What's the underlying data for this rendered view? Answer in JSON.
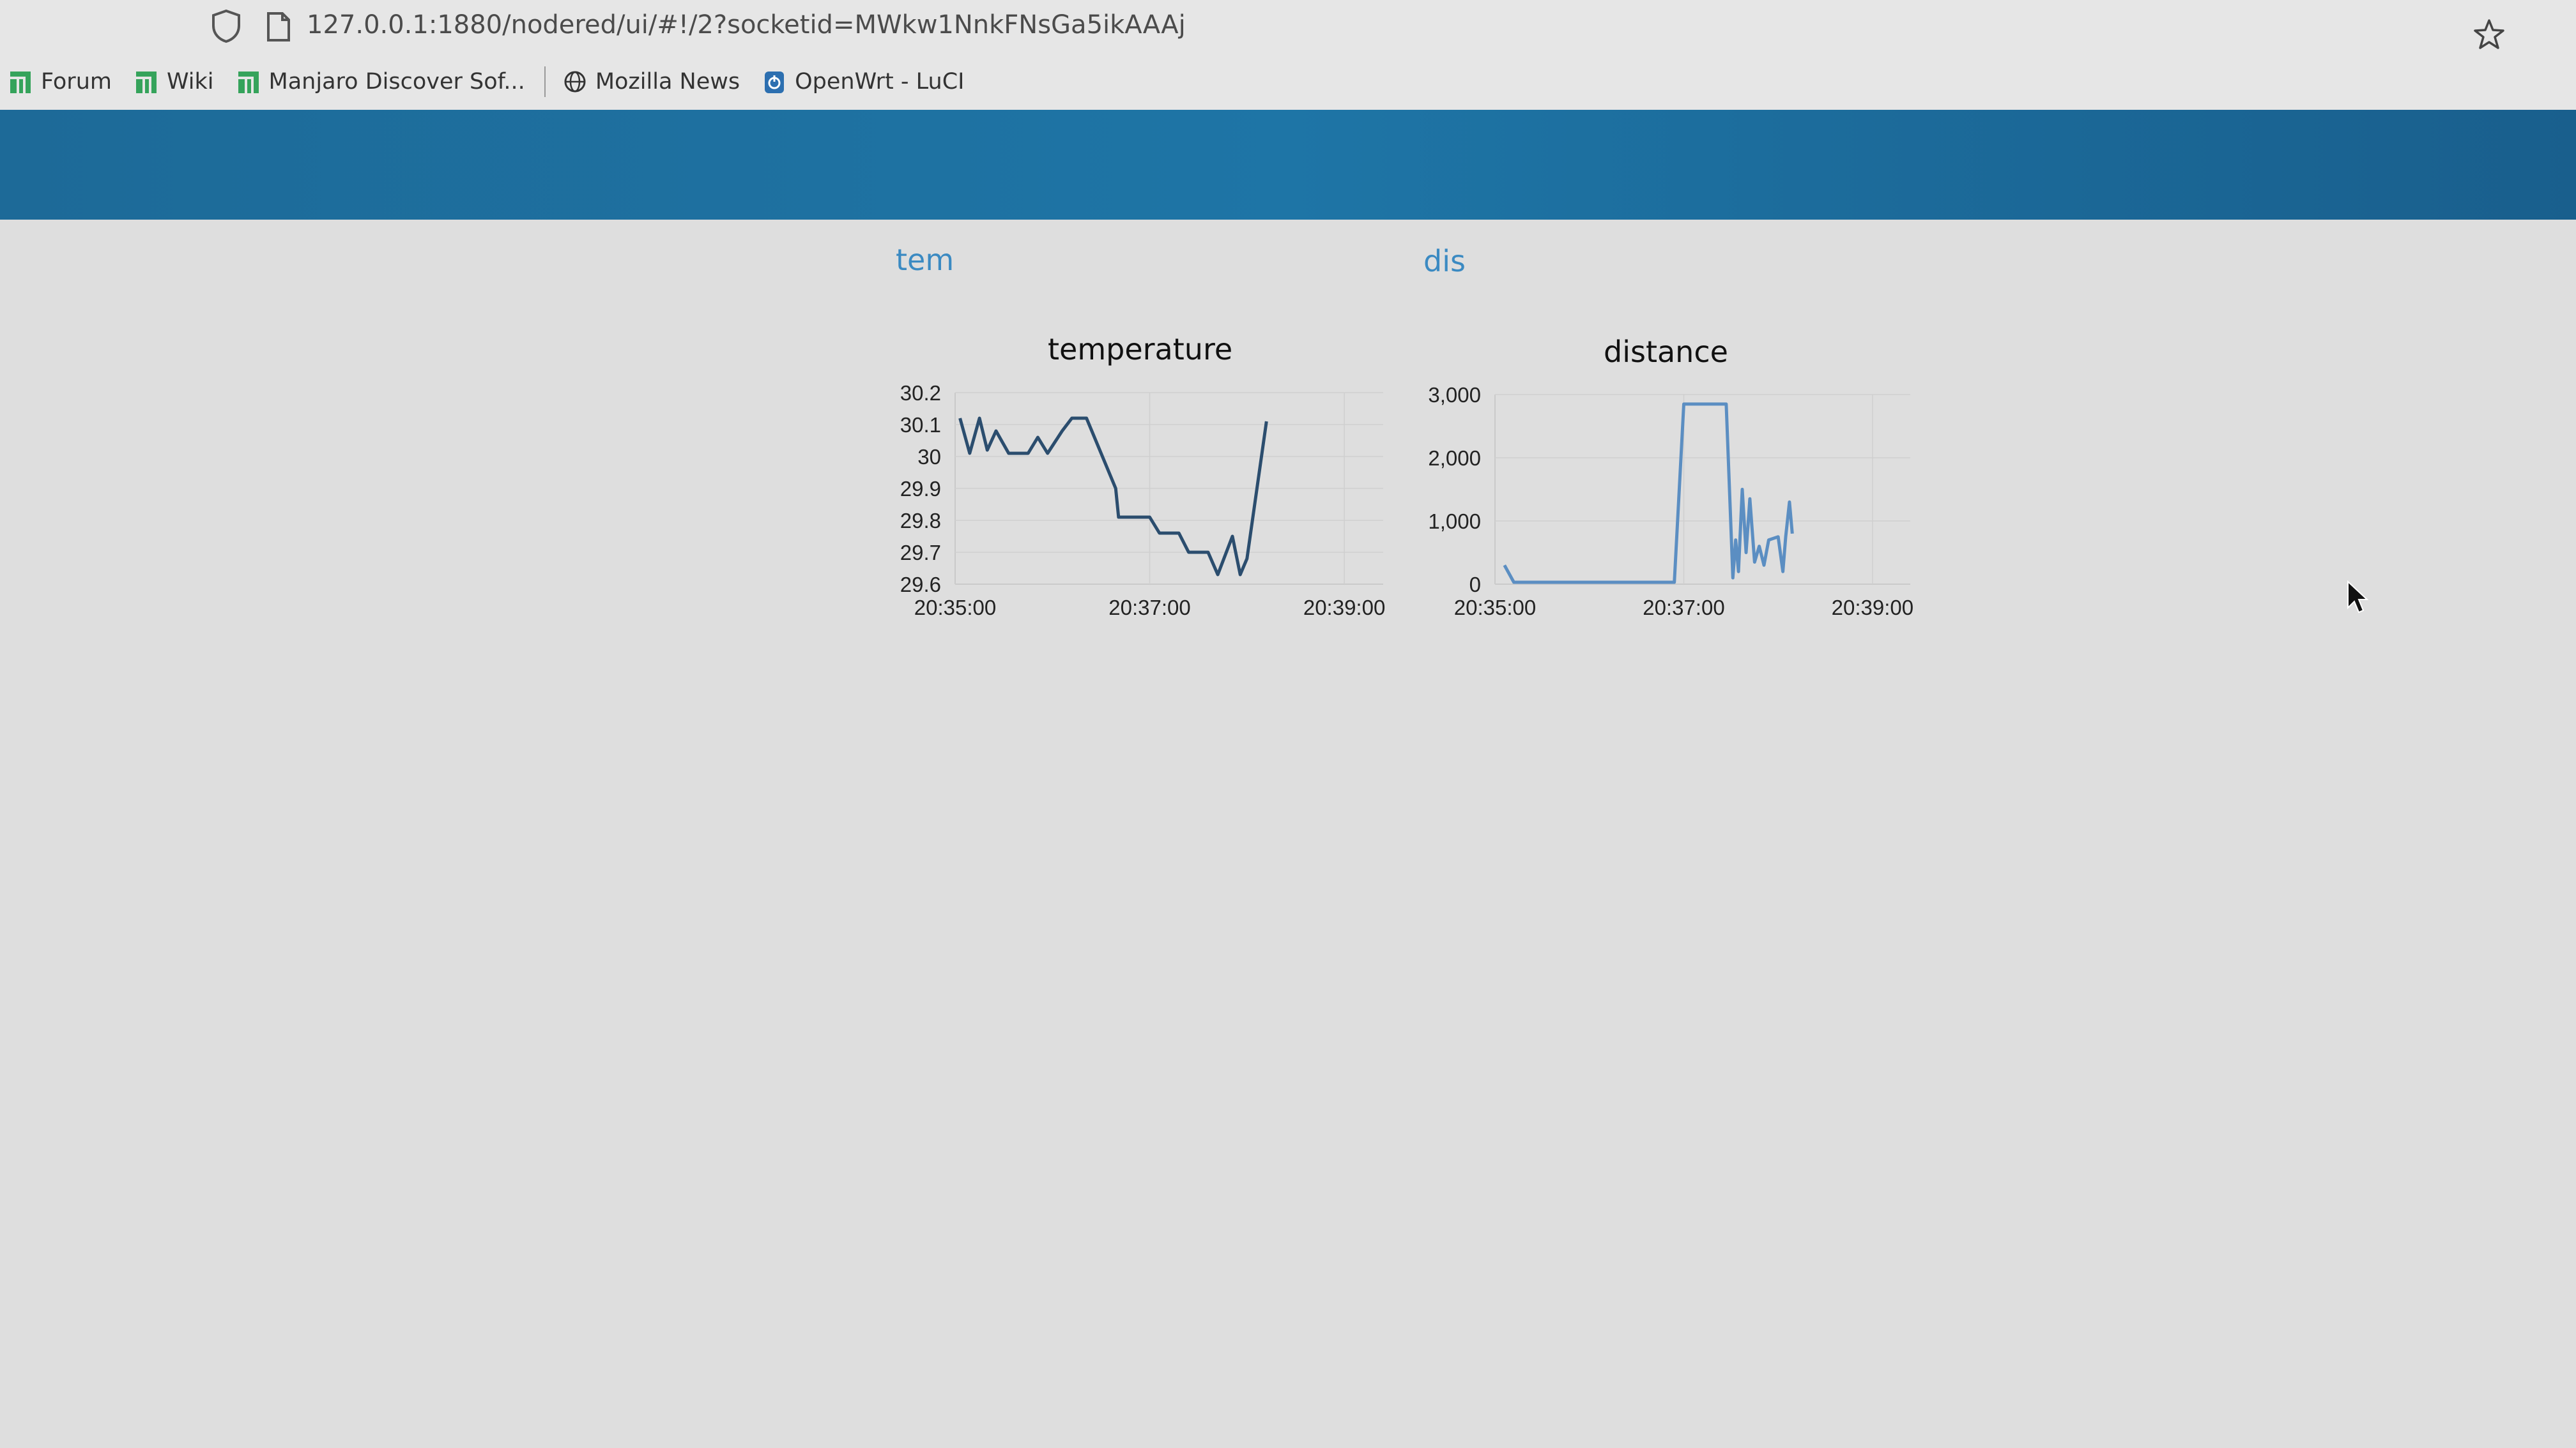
{
  "browser": {
    "url": "127.0.0.1:1880/nodered/ui/#!/2?socketid=MWkw1NnkFNsGa5ikAAAj",
    "bookmarks": [
      {
        "label": "Forum",
        "icon": "manjaro-icon"
      },
      {
        "label": "Wiki",
        "icon": "manjaro-icon"
      },
      {
        "label": "Manjaro Discover Sof...",
        "icon": "manjaro-icon"
      },
      {
        "label": "Mozilla News",
        "icon": "globe-icon"
      },
      {
        "label": "OpenWrt - LuCI",
        "icon": "openwrt-icon"
      }
    ]
  },
  "toolbar": {
    "color": "#1e75a6"
  },
  "groups": [
    {
      "title": "tem"
    },
    {
      "title": "dis"
    }
  ],
  "colors": {
    "temperature_line": "#2b4d6e",
    "distance_line": "#5b8ec2",
    "group_title": "#3b8ac2"
  },
  "chart_data": [
    {
      "type": "line",
      "title": "temperature",
      "xlabel": "",
      "ylabel": "",
      "x_ticks": [
        "20:35:00",
        "20:37:00",
        "20:39:00"
      ],
      "y_ticks": [
        "29.6",
        "29.7",
        "29.8",
        "29.9",
        "30",
        "30.1",
        "30.2"
      ],
      "x_range_minutes": [
        0,
        4.4
      ],
      "ylim": [
        29.6,
        30.2
      ],
      "grid": true,
      "series": [
        {
          "values": [
            [
              0.05,
              30.12
            ],
            [
              0.15,
              30.01
            ],
            [
              0.25,
              30.12
            ],
            [
              0.33,
              30.02
            ],
            [
              0.42,
              30.08
            ],
            [
              0.55,
              30.01
            ],
            [
              0.75,
              30.01
            ],
            [
              0.85,
              30.06
            ],
            [
              0.95,
              30.01
            ],
            [
              1.1,
              30.08
            ],
            [
              1.2,
              30.12
            ],
            [
              1.35,
              30.12
            ],
            [
              1.65,
              29.9
            ],
            [
              1.65,
              29.9
            ],
            [
              1.68,
              29.81
            ],
            [
              2.0,
              29.81
            ],
            [
              2.1,
              29.76
            ],
            [
              2.3,
              29.76
            ],
            [
              2.4,
              29.7
            ],
            [
              2.6,
              29.7
            ],
            [
              2.7,
              29.63
            ],
            [
              2.85,
              29.75
            ],
            [
              2.93,
              29.63
            ],
            [
              3.0,
              29.68
            ],
            [
              3.2,
              30.11
            ]
          ]
        }
      ]
    },
    {
      "type": "line",
      "title": "distance",
      "xlabel": "",
      "ylabel": "",
      "x_ticks": [
        "20:35:00",
        "20:37:00",
        "20:39:00"
      ],
      "y_ticks": [
        "0",
        "1,000",
        "2,000",
        "3,000"
      ],
      "x_range_minutes": [
        0,
        4.4
      ],
      "ylim": [
        0,
        3000
      ],
      "grid": true,
      "series": [
        {
          "values": [
            [
              0.1,
              300
            ],
            [
              0.2,
              30
            ],
            [
              0.6,
              30
            ],
            [
              1.2,
              30
            ],
            [
              1.9,
              30
            ],
            [
              2.0,
              2850
            ],
            [
              2.45,
              2850
            ],
            [
              2.52,
              100
            ],
            [
              2.55,
              700
            ],
            [
              2.58,
              200
            ],
            [
              2.62,
              1500
            ],
            [
              2.66,
              500
            ],
            [
              2.7,
              1350
            ],
            [
              2.75,
              350
            ],
            [
              2.8,
              600
            ],
            [
              2.85,
              300
            ],
            [
              2.9,
              700
            ],
            [
              3.0,
              750
            ],
            [
              3.05,
              200
            ],
            [
              3.08,
              750
            ],
            [
              3.12,
              1300
            ],
            [
              3.15,
              800
            ]
          ]
        }
      ]
    }
  ]
}
